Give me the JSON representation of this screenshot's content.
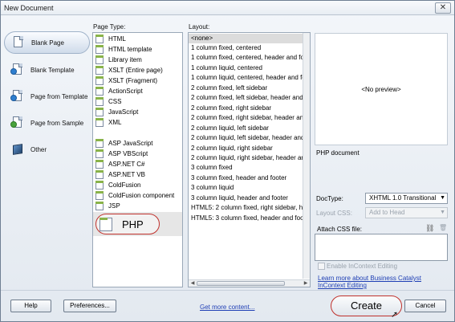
{
  "window": {
    "title": "New Document",
    "close_glyph": "✕"
  },
  "categories": [
    {
      "label": "Blank Page",
      "icon": "blank-page-icon",
      "selected": true
    },
    {
      "label": "Blank Template",
      "icon": "blank-template-icon",
      "selected": false
    },
    {
      "label": "Page from Template",
      "icon": "page-from-template-icon",
      "selected": false
    },
    {
      "label": "Page from Sample",
      "icon": "page-from-sample-icon",
      "selected": false
    },
    {
      "label": "Other",
      "icon": "other-icon",
      "selected": false
    }
  ],
  "page_type": {
    "label": "Page Type:",
    "items": [
      "HTML",
      "HTML template",
      "Library item",
      "XSLT (Entire page)",
      "XSLT (Fragment)",
      "ActionScript",
      "CSS",
      "JavaScript",
      "XML",
      "ASP JavaScript",
      "ASP VBScript",
      "ASP.NET C#",
      "ASP.NET VB",
      "ColdFusion",
      "ColdFusion component",
      "JSP",
      "PHP"
    ],
    "selected": "PHP"
  },
  "layout": {
    "label": "Layout:",
    "items": [
      "<none>",
      "1 column fixed, centered",
      "1 column fixed, centered, header and foot",
      "1 column liquid, centered",
      "1 column liquid, centered, header and foot",
      "2 column fixed, left sidebar",
      "2 column fixed, left sidebar, header and f",
      "2 column fixed, right sidebar",
      "2 column fixed, right sidebar, header and f",
      "2 column liquid, left sidebar",
      "2 column liquid, left sidebar, header and f",
      "2 column liquid, right sidebar",
      "2 column liquid, right sidebar, header and f",
      "3 column fixed",
      "3 column fixed, header and footer",
      "3 column liquid",
      "3 column liquid, header and footer",
      "HTML5: 2 column fixed, right sidebar, head",
      "HTML5: 3 column fixed, header and footer"
    ],
    "selected": "<none>"
  },
  "preview": {
    "text": "<No preview>",
    "description": "PHP document"
  },
  "form": {
    "doctype_label": "DocType:",
    "doctype_value": "XHTML 1.0 Transitional",
    "layout_css_label": "Layout CSS:",
    "layout_css_value": "Add to Head",
    "attach_css_label": "Attach CSS file:",
    "incontext_label": "Enable InContext Editing",
    "learn_more_line1": "Learn more about Business Catalyst",
    "learn_more_line2": "InContext Editing"
  },
  "footer": {
    "help": "Help",
    "preferences": "Preferences...",
    "get_more": "Get more content...",
    "create": "Create",
    "cancel": "Cancel"
  }
}
